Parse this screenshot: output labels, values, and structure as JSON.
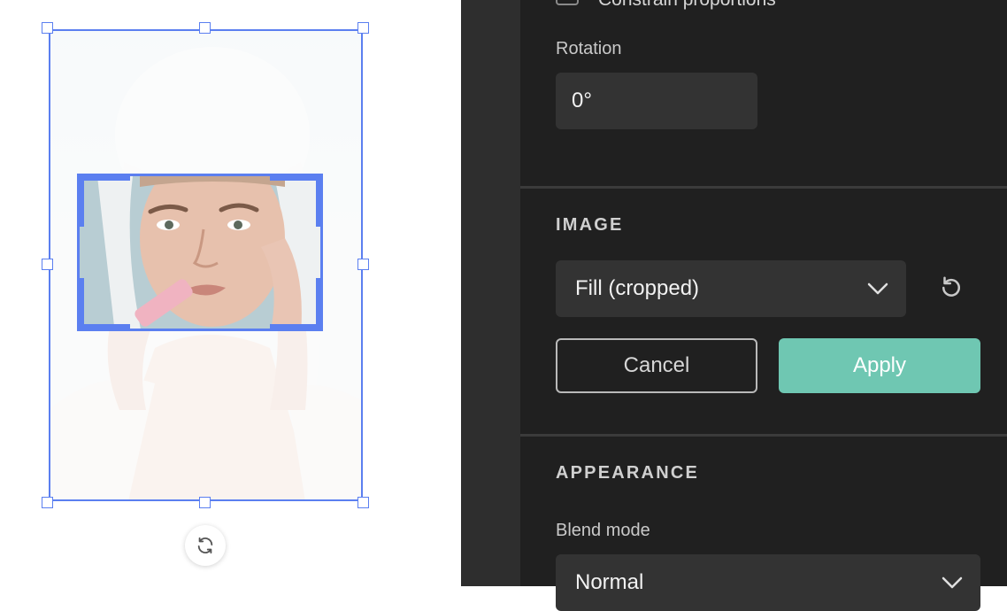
{
  "canvas": {
    "rotate_icon": "rotate-arrows-icon"
  },
  "panel": {
    "constrain": {
      "label": "Constrain proportions",
      "checked": false
    },
    "rotation": {
      "label": "Rotation",
      "value": "0°"
    },
    "image": {
      "heading": "IMAGE",
      "fill_mode": "Fill (cropped)",
      "reset_icon": "undo-icon",
      "cancel_label": "Cancel",
      "apply_label": "Apply"
    },
    "appearance": {
      "heading": "APPEARANCE",
      "blend_label": "Blend mode",
      "blend_value": "Normal"
    }
  },
  "colors": {
    "selection": "#5b7ff0",
    "accent": "#6fc7b2",
    "panel_bg": "#202020",
    "field_bg": "#333333"
  }
}
